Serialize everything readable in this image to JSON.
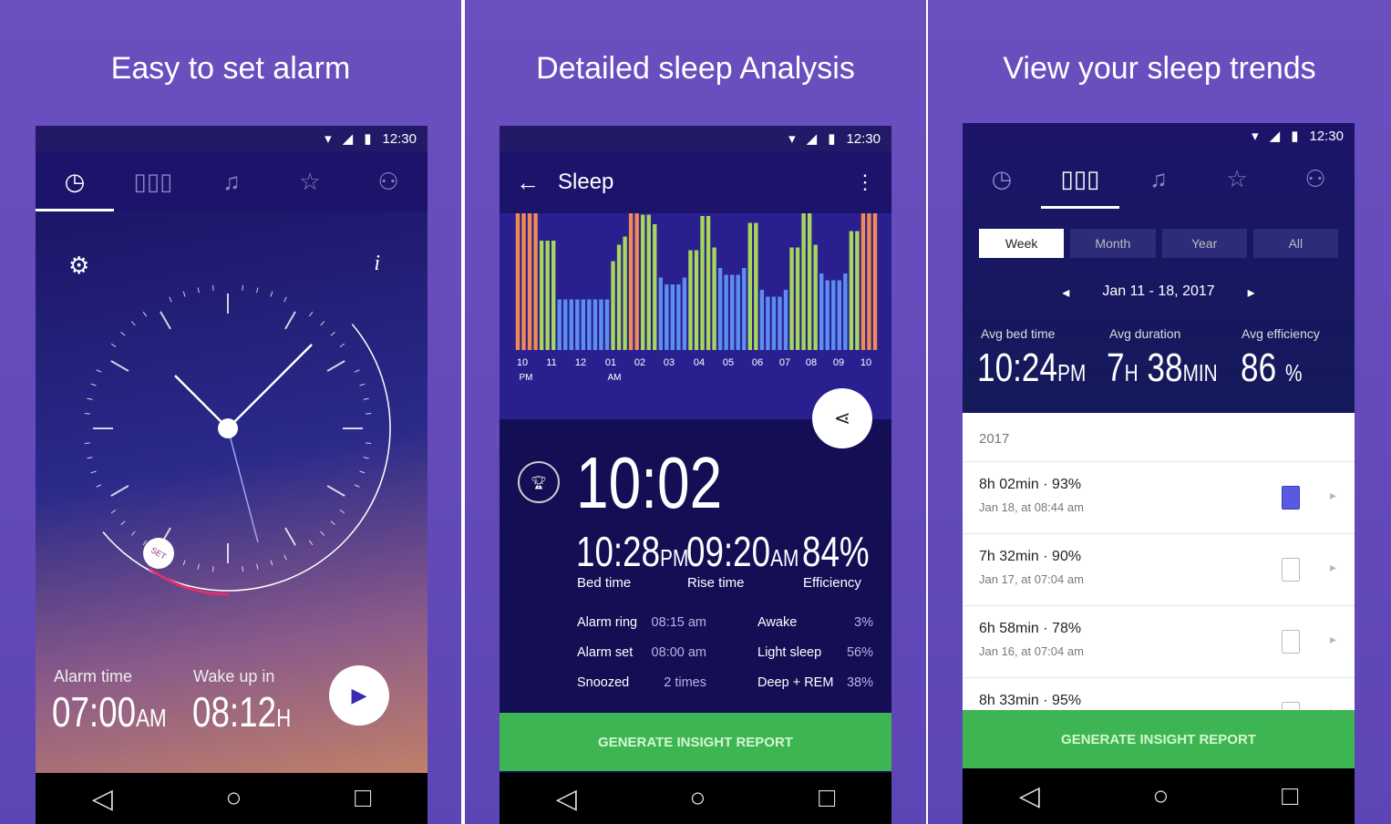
{
  "status_time": "12:30",
  "panels": [
    {
      "title": "Easy to set alarm"
    },
    {
      "title": "Detailed sleep Analysis"
    },
    {
      "title": "View your sleep trends"
    }
  ],
  "alarm": {
    "tabs": [
      "clock-icon",
      "stats-icon",
      "music-icon",
      "star-icon",
      "profile-icon"
    ],
    "info": "i",
    "set_badge": "SET",
    "alarm_label": "Alarm time",
    "alarm_value": "07:00",
    "alarm_unit": "AM",
    "wake_label": "Wake up in",
    "wake_value": "08:12",
    "wake_unit": "H"
  },
  "sleep": {
    "title": "Sleep",
    "chart_data": {
      "type": "bar",
      "x_ticks": [
        "10",
        "11",
        "12",
        "01",
        "02",
        "03",
        "04",
        "05",
        "06",
        "07",
        "08",
        "09",
        "10"
      ],
      "x_subticks": [
        "PM",
        "",
        "",
        "AM",
        "",
        "",
        "",
        "",
        "",
        "",
        "",
        "",
        ""
      ],
      "stage_colors": {
        "awake": "#ee8a55",
        "light": "#a6d65a",
        "deep": "#5c8df0"
      },
      "values": [
        1,
        1,
        1,
        1,
        0.8,
        0.8,
        0.8,
        0.37,
        0.37,
        0.37,
        0.37,
        0.37,
        0.37,
        0.37,
        0.37,
        0.37,
        0.65,
        0.77,
        0.83,
        1,
        1,
        0.99,
        0.99,
        0.92,
        0.53,
        0.48,
        0.48,
        0.48,
        0.53,
        0.73,
        0.73,
        0.98,
        0.98,
        0.75,
        0.6,
        0.55,
        0.55,
        0.55,
        0.6,
        0.93,
        0.93,
        0.44,
        0.39,
        0.39,
        0.39,
        0.44,
        0.75,
        0.75,
        1,
        1,
        0.77,
        0.56,
        0.51,
        0.51,
        0.51,
        0.56,
        0.87,
        0.87,
        1,
        1,
        1
      ],
      "stages": [
        "awake",
        "awake",
        "awake",
        "awake",
        "light",
        "light",
        "light",
        "deep",
        "deep",
        "deep",
        "deep",
        "deep",
        "deep",
        "deep",
        "deep",
        "deep",
        "light",
        "light",
        "light",
        "awake",
        "awake",
        "light",
        "light",
        "light",
        "deep",
        "deep",
        "deep",
        "deep",
        "deep",
        "light",
        "light",
        "light",
        "light",
        "light",
        "deep",
        "deep",
        "deep",
        "deep",
        "deep",
        "light",
        "light",
        "deep",
        "deep",
        "deep",
        "deep",
        "deep",
        "light",
        "light",
        "light",
        "light",
        "light",
        "deep",
        "deep",
        "deep",
        "deep",
        "deep",
        "light",
        "light",
        "awake",
        "awake",
        "awake"
      ]
    },
    "total": "10:02",
    "bed_value": "10:28",
    "bed_unit": "PM",
    "bed_label": "Bed time",
    "rise_value": "09:20",
    "rise_unit": "AM",
    "rise_label": "Rise time",
    "eff_value": "84%",
    "eff_label": "Efficiency",
    "details": [
      {
        "label": "Alarm ring",
        "value": "08:15 am"
      },
      {
        "label": "Alarm set",
        "value": "08:00 am"
      },
      {
        "label": "Snoozed",
        "value": "2 times"
      }
    ],
    "stages_pct": [
      {
        "label": "Awake",
        "value": "3%"
      },
      {
        "label": "Light sleep",
        "value": "56%"
      },
      {
        "label": "Deep + REM",
        "value": "38%"
      }
    ],
    "cta": "GENERATE INSIGHT REPORT"
  },
  "trends": {
    "ranges": [
      "Week",
      "Month",
      "Year",
      "All"
    ],
    "active_range": "Week",
    "date_range": "Jan 11 - 18, 2017",
    "avg_bed_label": "Avg bed time",
    "avg_bed_value": "10:24",
    "avg_bed_unit": "PM",
    "avg_dur_label": "Avg duration",
    "avg_dur_h": "7",
    "avg_dur_h_unit": "H",
    "avg_dur_m": "38",
    "avg_dur_m_unit": "MIN",
    "avg_eff_label": "Avg efficiency",
    "avg_eff_value": "86",
    "avg_eff_unit": "%",
    "year": "2017",
    "entries": [
      {
        "duration": "8h 02min",
        "pct": "93%",
        "date": "Jan 18, at 08:44 am",
        "has_report": true
      },
      {
        "duration": "7h 32min",
        "pct": "90%",
        "date": "Jan 17, at 07:04 am",
        "has_report": false
      },
      {
        "duration": "6h 58min",
        "pct": "78%",
        "date": "Jan 16, at 07:04 am",
        "has_report": false
      },
      {
        "duration": "8h 33min",
        "pct": "95%",
        "date": "",
        "has_report": false
      }
    ],
    "cta": "GENERATE INSIGHT REPORT"
  }
}
